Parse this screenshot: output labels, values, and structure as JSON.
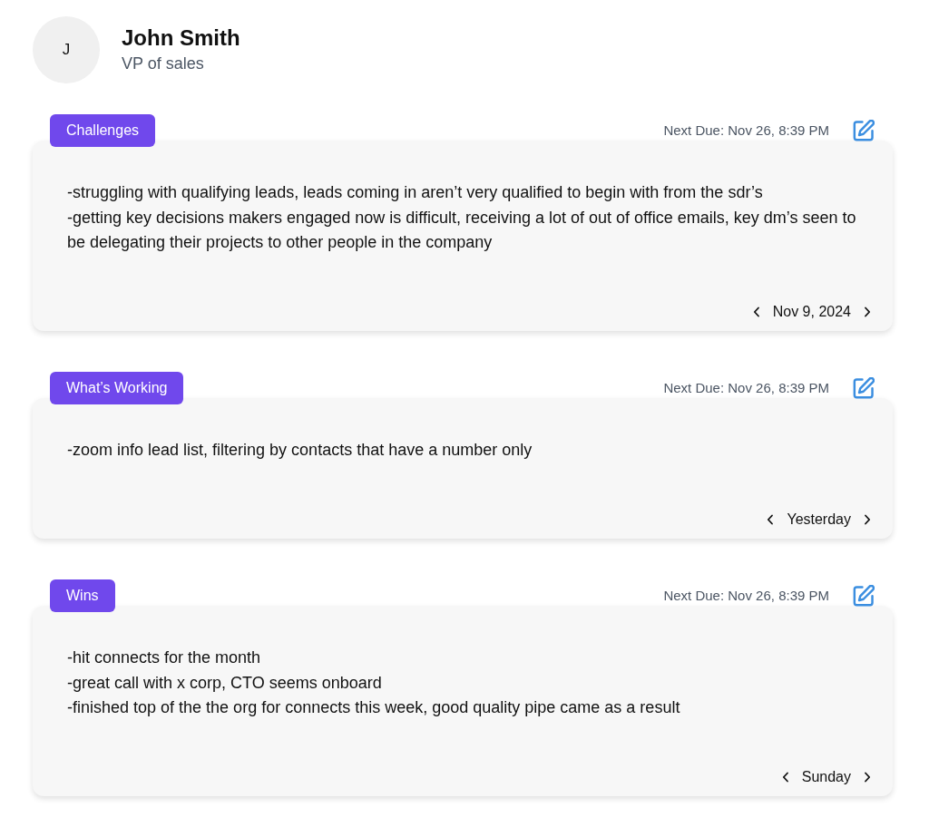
{
  "profile": {
    "initial": "J",
    "name": "John Smith",
    "title": "VP of sales"
  },
  "sections": [
    {
      "label": "Challenges",
      "next_due": "Next Due: Nov 26, 8:39 PM",
      "notes": [
        "-struggling with qualifying leads, leads coming in aren’t very qualified to begin with from the sdr’s",
        "-getting key decisions makers engaged now is difficult, receiving a lot of out of office emails, key dm’s seen to be delegating their projects to other people in the company"
      ],
      "date": "Nov 9, 2024"
    },
    {
      "label": "What’s Working",
      "next_due": "Next Due: Nov 26, 8:39 PM",
      "notes": [
        "-zoom info lead list, filtering by contacts that have a number only"
      ],
      "date": "Yesterday"
    },
    {
      "label": "Wins",
      "next_due": "Next Due: Nov 26, 8:39 PM",
      "notes": [
        "-hit connects for the month",
        "-great call with x corp, CTO seems onboard",
        "-finished top of the the org for connects this week, good quality pipe came as a result"
      ],
      "date": "Sunday"
    }
  ]
}
